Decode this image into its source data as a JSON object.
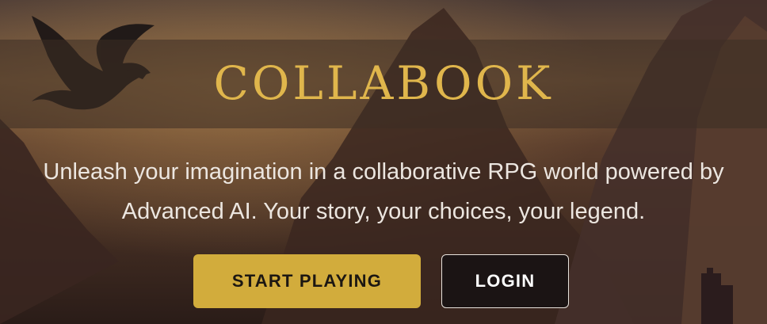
{
  "hero": {
    "title": "COLLABOOK",
    "tagline_line1": "Unleash your imagination in a collaborative RPG world powered by",
    "tagline_line2": "Advanced AI. Your story, your choices, your legend."
  },
  "actions": {
    "start_label": "START PLAYING",
    "login_label": "LOGIN"
  },
  "colors": {
    "title_gold": "#e0b64c",
    "button_gold": "#d2ac3c",
    "login_bg": "#1b1414"
  },
  "icons": [
    "dragon-icon"
  ]
}
